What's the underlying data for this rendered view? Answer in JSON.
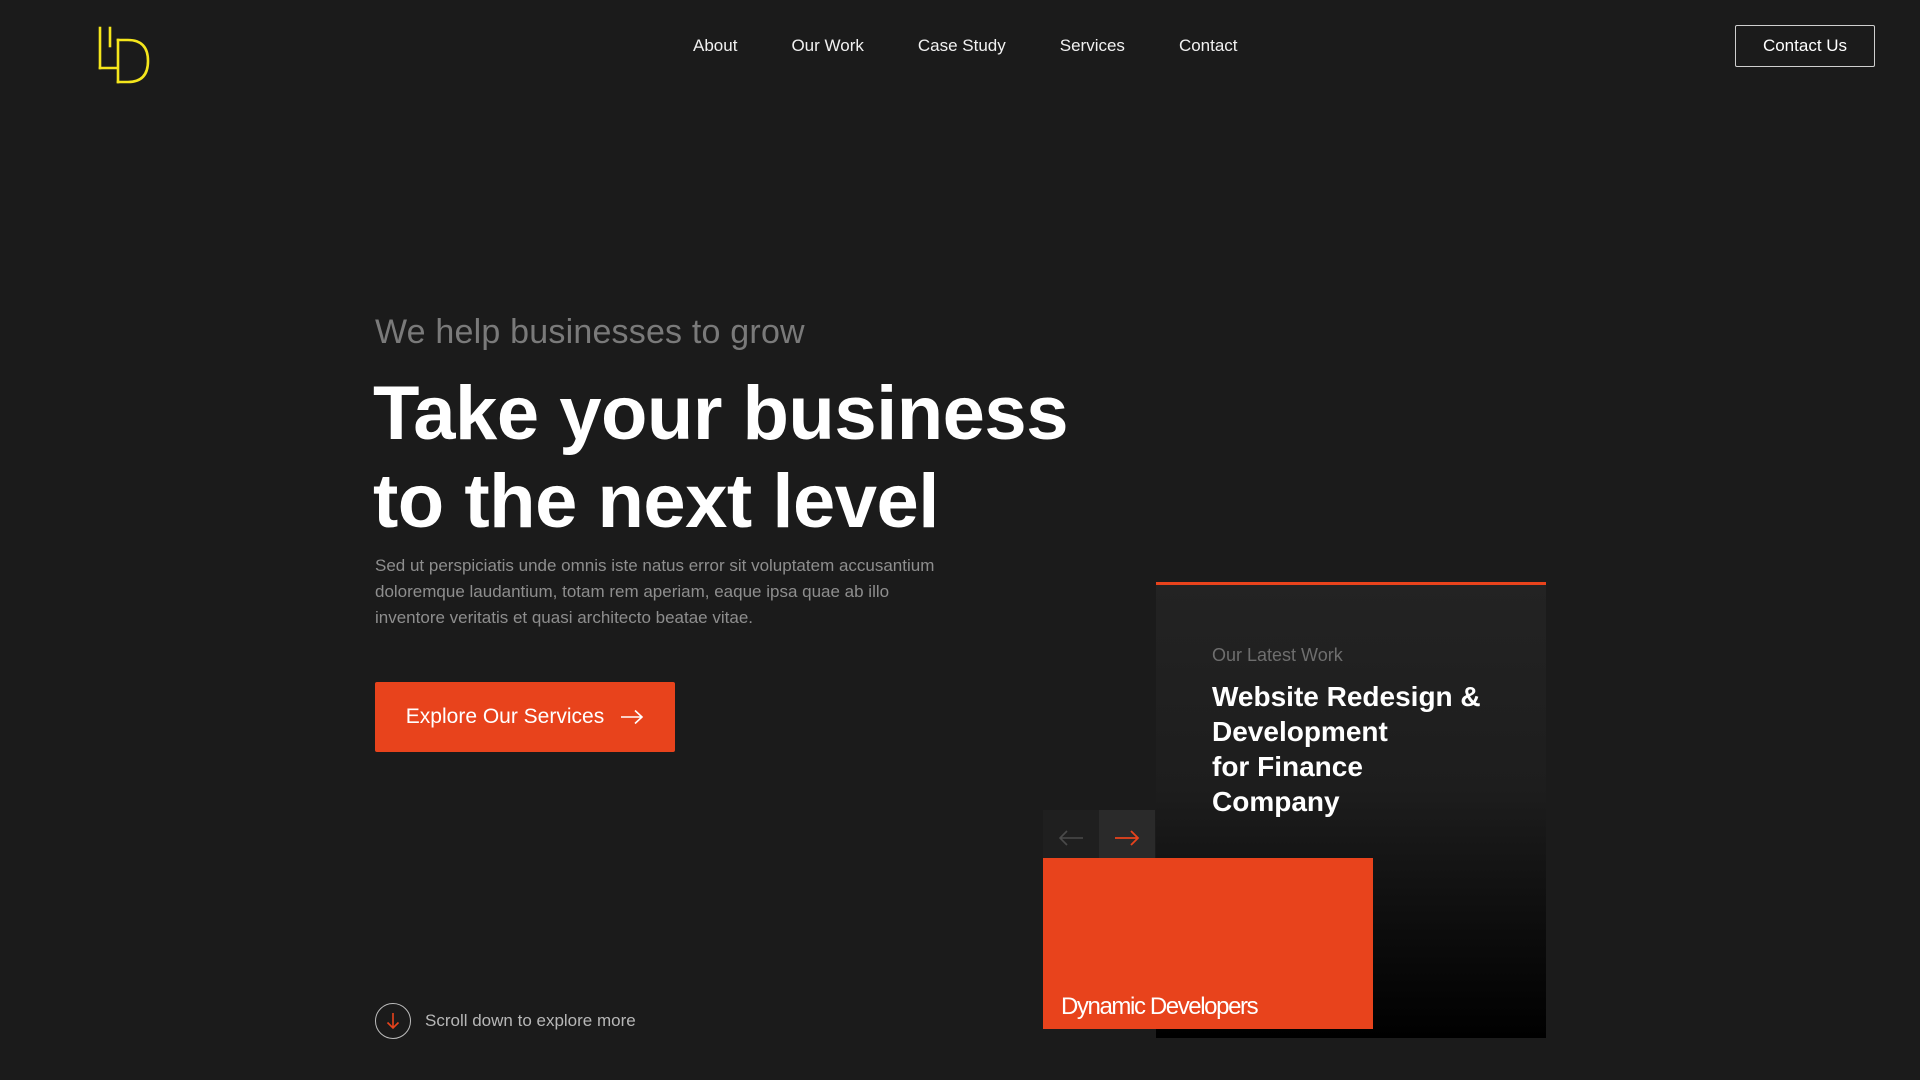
{
  "brand": {
    "logo_color": "#f5e61c",
    "accent_color": "#e8431c",
    "background_color": "#1b1b1b"
  },
  "nav": {
    "items": [
      {
        "label": "About"
      },
      {
        "label": "Our Work"
      },
      {
        "label": "Case Study"
      },
      {
        "label": "Services"
      },
      {
        "label": "Contact"
      }
    ],
    "cta_label": "Contact Us"
  },
  "hero": {
    "eyebrow": "We help businesses to grow",
    "headline_line1": "Take your business",
    "headline_line2": "to the next level",
    "body": "Sed ut perspiciatis unde omnis iste natus error sit voluptatem accusantium doloremque laudantium, totam rem aperiam, eaque ipsa quae ab illo inventore veritatis et quasi architecto beatae vitae.",
    "cta_label": "Explore Our Services",
    "cta_icon": "arrow-right-icon"
  },
  "scroll": {
    "label": "Scroll down to explore more",
    "icon": "arrow-down-icon"
  },
  "latest_work": {
    "eyebrow": "Our Latest Work",
    "title_line1": "Website Redesign &",
    "title_line2": "Development",
    "title_line3": "for Finance",
    "title_line4": "Company",
    "prev_icon": "arrow-left-icon",
    "next_icon": "arrow-right-icon",
    "tile_label": "Dynamic Developers"
  }
}
